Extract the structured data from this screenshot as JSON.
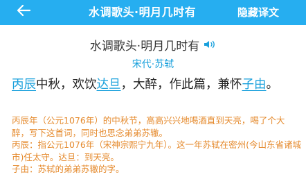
{
  "header": {
    "back_icon": "back-arrow-icon",
    "title": "水调歌头·明月几时有",
    "action_label": "隐藏译文",
    "background": "#26aef0"
  },
  "poem": {
    "title": "水调歌头·明月几时有",
    "audio_icon": "speaker-icon",
    "author": "宋代·苏轼",
    "preface": [
      {
        "text": "丙辰",
        "term": true
      },
      {
        "text": "中秋，欢饮",
        "term": false
      },
      {
        "text": "达旦",
        "term": true
      },
      {
        "text": "，大醉，作此篇，兼怀",
        "term": false
      },
      {
        "text": "子由",
        "term": true
      },
      {
        "text": "。",
        "term": false
      }
    ],
    "translation": "丙辰年（公元1076年）的中秋节，高高兴兴地喝酒直到天亮，喝了个大醉，写下这首词，同时也思念弟弟苏辙。",
    "annotation_1": "丙辰：指公元1076年（宋神宗熙宁九年）。这一年苏轼在密州(今山东省诸城市)任太守。达旦：到天亮。",
    "annotation_2": "子由：苏轼的弟弟苏辙的字。"
  },
  "colors": {
    "accent": "#26aef0",
    "term": "#19a0dc",
    "translation": "#e58a2d",
    "text": "#222222"
  }
}
